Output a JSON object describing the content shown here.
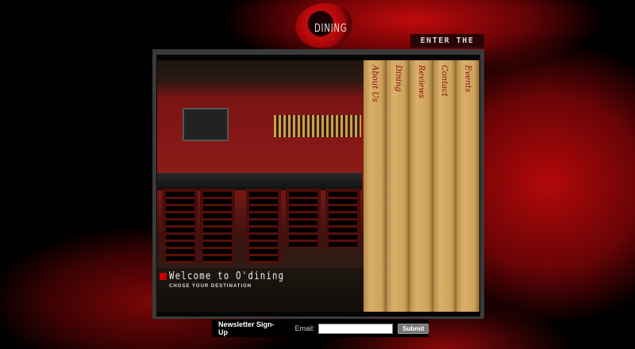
{
  "header": {
    "logo_text": "DINING",
    "enter_link": "ENTER THE LOUNGE"
  },
  "hero": {
    "title": "Welcome to O'dining",
    "subtitle": "CHOSE YOUR DESTINATION"
  },
  "tabs": [
    {
      "label": "About Us"
    },
    {
      "label": "Dining"
    },
    {
      "label": "Reviews"
    },
    {
      "label": "Contact"
    },
    {
      "label": "Events"
    }
  ],
  "newsletter": {
    "label": "Newsletter Sign-Up",
    "email_label": "Email:",
    "email_value": "",
    "submit": "Submit"
  },
  "colors": {
    "accent": "#c00a0c",
    "tab_text": "#8a0e0e",
    "tab_bg": "#d9b06a"
  }
}
